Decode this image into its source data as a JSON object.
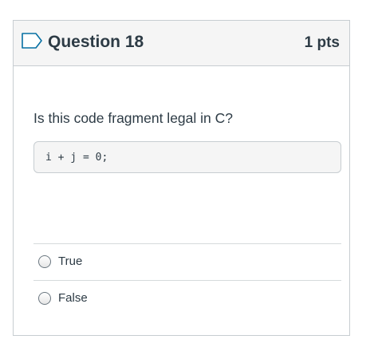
{
  "question": {
    "title": "Question 18",
    "points": "1 pts",
    "flag_icon": "bookmark-flag-icon",
    "text": "Is this code fragment legal in C?",
    "code": "i + j = 0;"
  },
  "answers": [
    {
      "label": "True",
      "selected": false
    },
    {
      "label": "False",
      "selected": false
    }
  ],
  "colors": {
    "header_bg": "#f5f5f5",
    "border": "#c7cdd1",
    "text": "#2d3b45",
    "flag_outline": "#0770a3"
  }
}
